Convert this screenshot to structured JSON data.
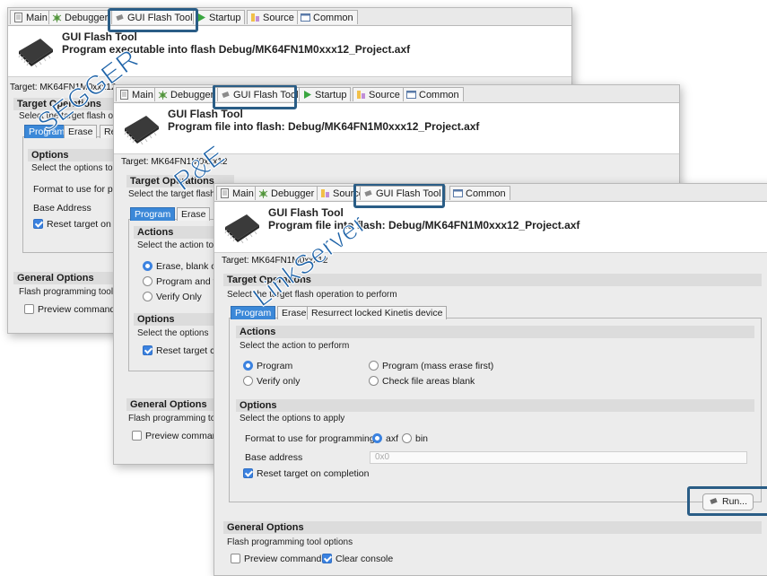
{
  "panel1": {
    "tabs": [
      {
        "label": "Main",
        "icon": "document-icon"
      },
      {
        "label": "Debugger",
        "icon": "bug-icon"
      },
      {
        "label": "GUI Flash Tool",
        "icon": "chip-icon"
      },
      {
        "label": "Startup",
        "icon": "play-icon"
      },
      {
        "label": "Source",
        "icon": "source-icon"
      },
      {
        "label": "Common",
        "icon": "window-icon"
      }
    ],
    "title": "GUI Flash Tool",
    "subtitle": "Program executable into flash Debug/MK64FN1M0xxx12_Project.axf",
    "target": "Target: MK64FN1M0xxx12",
    "target_ops": "Target Operations",
    "target_ops_desc": "Select the target flash o",
    "subtabs": [
      "Program",
      "Erase",
      "Re"
    ],
    "options_title": "Options",
    "options_desc": "Select the options to",
    "format_label": "Format to use for pr",
    "base_address_label": "Base Address",
    "reset_label": "Reset target on",
    "general_title": "General Options",
    "general_desc": "Flash programming tool",
    "preview_label": "Preview command",
    "watermark": "SEGGER"
  },
  "panel2": {
    "tabs": [
      {
        "label": "Main",
        "icon": "document-icon"
      },
      {
        "label": "Debugger",
        "icon": "bug-icon"
      },
      {
        "label": "GUI Flash Tool",
        "icon": "chip-icon"
      },
      {
        "label": "Startup",
        "icon": "play-icon"
      },
      {
        "label": "Source",
        "icon": "source-icon"
      },
      {
        "label": "Common",
        "icon": "window-icon"
      }
    ],
    "title": "GUI Flash Tool",
    "subtitle": "Program file into flash: Debug/MK64FN1M0xxx12_Project.axf",
    "target": "Target: MK64FN1M0xxx12",
    "target_ops": "Target Operations",
    "target_ops_desc": "Select the target flash",
    "subtabs": [
      "Program",
      "Erase"
    ],
    "actions_title": "Actions",
    "actions_desc": "Select the action to",
    "radios": [
      "Erase, blank c",
      "Program and v",
      "Verify Only"
    ],
    "options_title": "Options",
    "options_desc": "Select the options",
    "reset_label": "Reset target c",
    "general_title": "General Options",
    "general_desc": "Flash programming to",
    "preview_label": "Preview comman",
    "watermark": "P&E"
  },
  "panel3": {
    "tabs": [
      {
        "label": "Main",
        "icon": "document-icon"
      },
      {
        "label": "Debugger",
        "icon": "bug-icon"
      },
      {
        "label": "Source",
        "icon": "source-icon"
      },
      {
        "label": "GUI Flash Tool",
        "icon": "chip-icon"
      },
      {
        "label": "Common",
        "icon": "window-icon"
      }
    ],
    "title": "GUI Flash Tool",
    "subtitle": "Program file into flash: Debug/MK64FN1M0xxx12_Project.axf",
    "target": "Target: MK64FN1M0xxx12",
    "target_ops": "Target Operations",
    "target_ops_desc": "Select the target flash operation to perform",
    "subtabs": [
      "Program",
      "Erase",
      "Resurrect locked Kinetis device"
    ],
    "actions_title": "Actions",
    "actions_desc": "Select the action to perform",
    "radio_program": "Program",
    "radio_mass": "Program (mass erase first)",
    "radio_verify": "Verify only",
    "radio_check": "Check file areas blank",
    "options_title": "Options",
    "options_desc": "Select the options to apply",
    "format_label": "Format to use for programming",
    "format_axf": "axf",
    "format_bin": "bin",
    "base_address_label": "Base address",
    "base_address_value": "0x0",
    "reset_label": "Reset target on completion",
    "run_label": "Run...",
    "general_title": "General Options",
    "general_desc": "Flash programming tool options",
    "preview_label": "Preview command",
    "clear_console_label": "Clear console",
    "watermark": "LinkServer"
  },
  "colors": {
    "accent": "#3b82e0",
    "highlight": "#2a5d86",
    "watermark": "#1e63a8"
  }
}
